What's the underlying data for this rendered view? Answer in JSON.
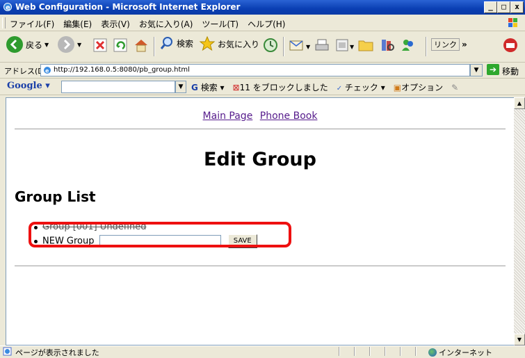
{
  "window": {
    "title": "Web Configuration - Microsoft Internet Explorer",
    "min_label": "_",
    "max_label": "□",
    "close_label": "x"
  },
  "menu": [
    "ファイル(F)",
    "編集(E)",
    "表示(V)",
    "お気に入り(A)",
    "ツール(T)",
    "ヘルプ(H)"
  ],
  "toolbar": {
    "back_label": "戻る",
    "search_label": "検索",
    "favorites_label": "お気に入り",
    "links_label": "リンク",
    "chevron": "»"
  },
  "address": {
    "label": "アドレス(D)",
    "url": "http://192.168.0.5:8080/pb_group.html",
    "go_label": "移動"
  },
  "google": {
    "logo": "Google",
    "search_label": "検索",
    "popup_label": "11 をブロックしました",
    "check_label": "チェック",
    "options_label": "オプション"
  },
  "page": {
    "nav_main": "Main Page",
    "nav_phonebook": "Phone Book",
    "title": "Edit Group",
    "section": "Group List",
    "group_item": "Group [001] Undefined",
    "new_group_label": "NEW Group",
    "new_group_value": "",
    "save_label": "SAVE"
  },
  "status": {
    "text": "ページが表示されました",
    "zone": "インターネット"
  },
  "colors": {
    "titlebar": "#0a3fb3",
    "highlight": "#ee1010",
    "link": "#551a8b"
  }
}
